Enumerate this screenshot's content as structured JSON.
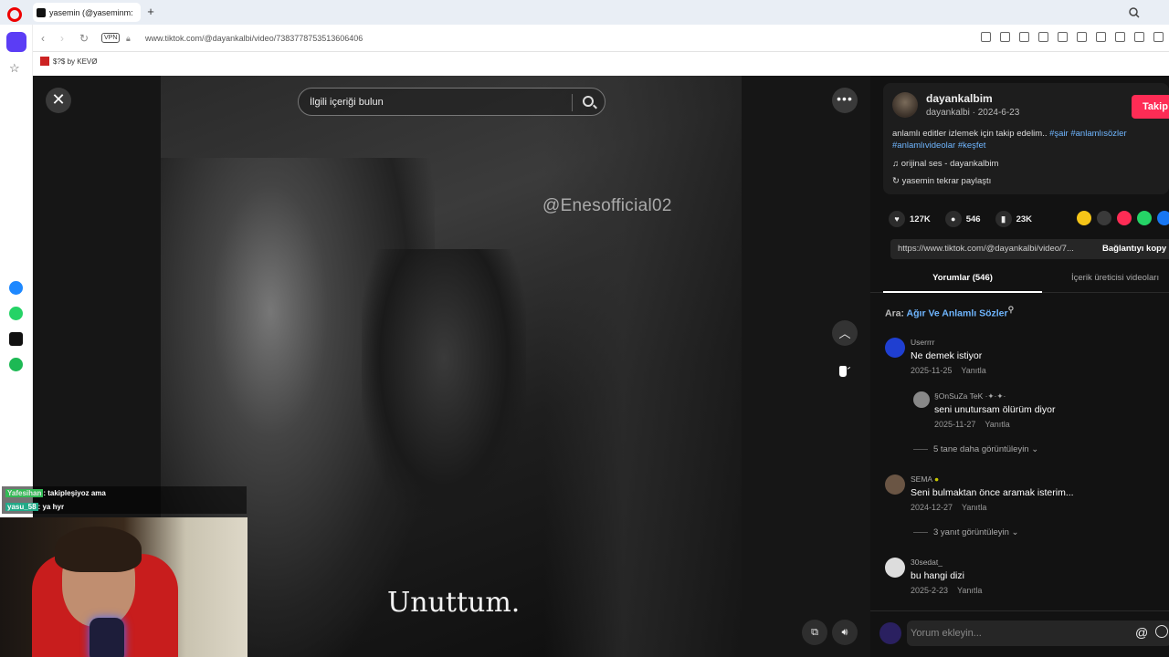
{
  "browser": {
    "tab_title": "yasemin (@yaseminm:",
    "url": "www.tiktok.com/@dayankalbi/video/7383778753513606406",
    "vpn_label": "VPN",
    "bookmark": "$?$ by KEVØ"
  },
  "video": {
    "search_placeholder": "İlgili içeriği bulun",
    "watermark": "@Enesofficial02",
    "subtitle": "Unuttum."
  },
  "author": {
    "name": "dayankalbim",
    "handle_date": "dayankalbi · 2024-6-23",
    "follow_label": "Takip",
    "description_text": "anlamlı editler izlemek için takip edelim.. ",
    "tags_line1": "#şair #anlamlısözler",
    "tags_line2": "#anlamlıvideolar #keşfet",
    "music": "orijinal ses - dayankalbim",
    "repost": "yasemin tekrar paylaştı"
  },
  "stats": {
    "likes": "127K",
    "comments": "546",
    "saves": "23K"
  },
  "share_colors": [
    "#f5c518",
    "#3a3a3a",
    "#fe2c55",
    "#25d366",
    "#1877f2"
  ],
  "link": {
    "url": "https://www.tiktok.com/@dayankalbi/video/7...",
    "copy_label": "Bağlantıyı kopy"
  },
  "tabs": {
    "comments": "Yorumlar (546)",
    "creator": "İçerik üreticisi videoları"
  },
  "search_suggest": {
    "prefix": "Ara:",
    "keyword": "Ağır Ve Anlamlı Sözler"
  },
  "comments": [
    {
      "user": "Userrrr",
      "text": "Ne demek istiyor",
      "date": "2025-11-25",
      "reply": "Yanıtla",
      "avatar_color": "#1f3fd1"
    },
    {
      "user": "§OnSuZa TeK ·✦·✦·",
      "text": "seni unutursam ölürüm diyor",
      "date": "2025-11-27",
      "reply": "Yanıtla",
      "avatar_color": "#888888"
    },
    {
      "user": "SEMA",
      "text": "Seni bulmaktan önce aramak isterim...",
      "date": "2024-12-27",
      "reply": "Yanıtla",
      "avatar_color": "#6a5544"
    },
    {
      "user": "30sedat_",
      "text": "bu hangi dizi",
      "date": "2025-2-23",
      "reply": "Yanıtla",
      "avatar_color": "#dddddd"
    }
  ],
  "view_more": {
    "first": "5 tane daha görüntüleyin",
    "second": "3 yanıt görüntüleyin"
  },
  "comment_input": {
    "placeholder": "Yorum ekleyin..."
  },
  "stream_chat": [
    {
      "user": "Yafesihan",
      "message": ": takipleşiyoz ama"
    },
    {
      "user": "yasu_58",
      "message": ": ya hyr"
    }
  ]
}
